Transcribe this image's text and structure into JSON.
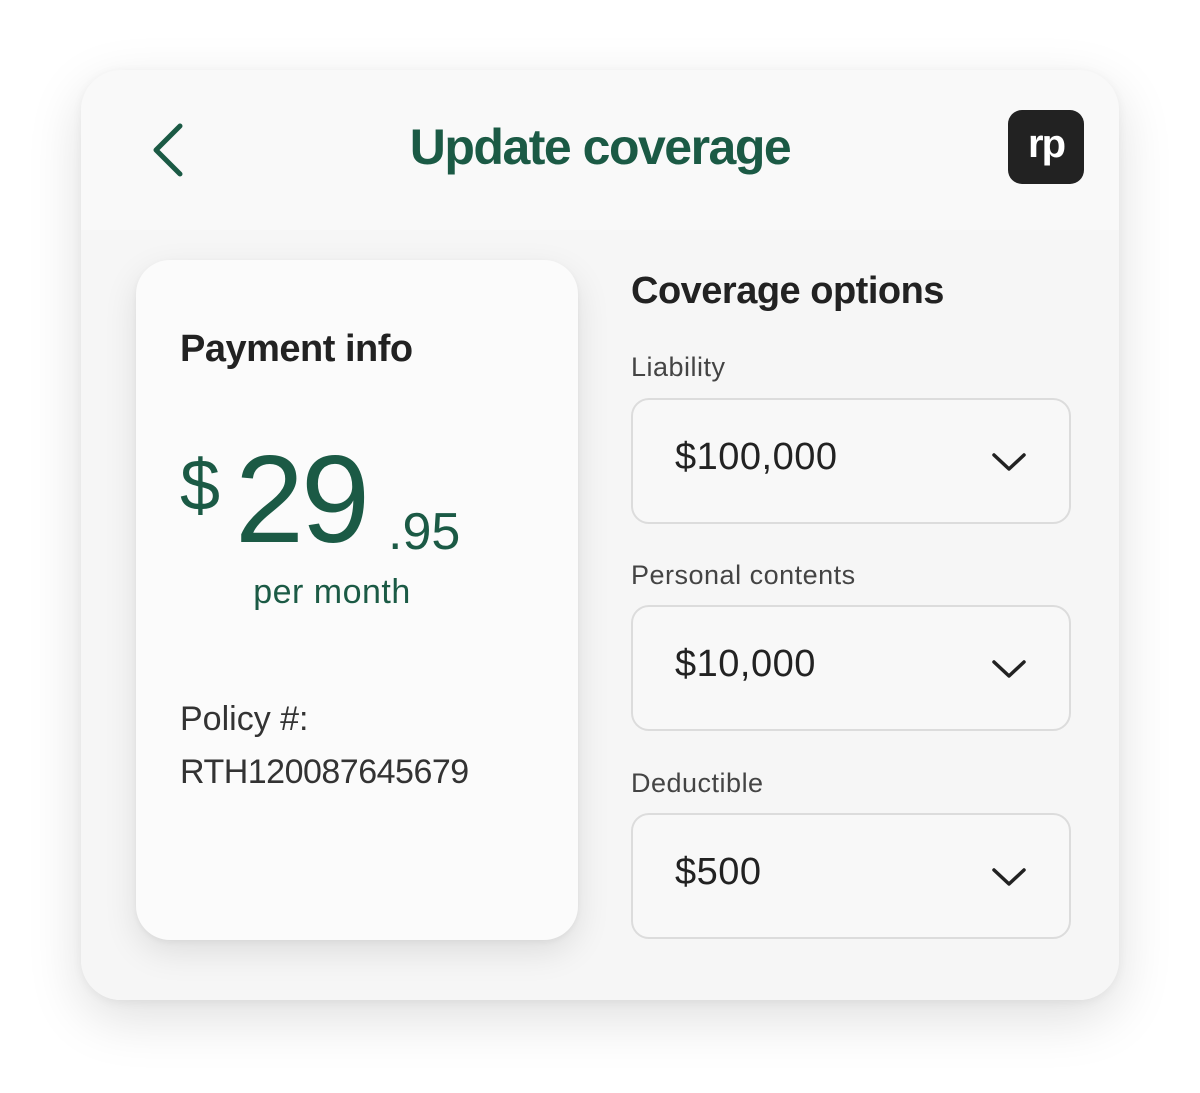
{
  "header": {
    "title": "Update coverage",
    "back_icon": "chevron-left-icon",
    "logo_text": "rp"
  },
  "payment": {
    "title": "Payment info",
    "price": {
      "currency": "$",
      "dollars": "29",
      "cents": ".95",
      "period": "per month"
    },
    "policy_label": "Policy #:",
    "policy_number": "RTH120087645679"
  },
  "coverage": {
    "title": "Coverage options",
    "fields": [
      {
        "label": "Liability",
        "value": "$100,000",
        "icon": "chevron-down-icon"
      },
      {
        "label": "Personal contents",
        "value": "$10,000",
        "icon": "chevron-down-icon"
      },
      {
        "label": "Deductible",
        "value": "$500",
        "icon": "chevron-down-icon"
      }
    ]
  },
  "colors": {
    "brand_green": "#1b5a45",
    "logo_bg": "#222222",
    "text_dark": "#222222"
  }
}
